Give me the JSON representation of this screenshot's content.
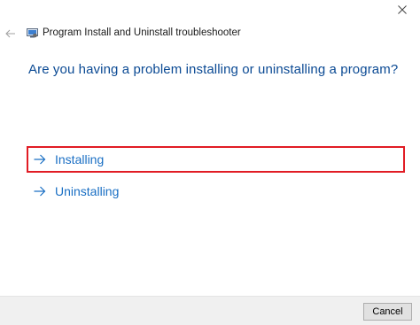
{
  "window": {
    "title": "Program Install and Uninstall troubleshooter",
    "close_icon": "close-icon",
    "back_icon": "back-arrow-icon",
    "app_icon": "troubleshooter-app-icon"
  },
  "main": {
    "question": "Are you having a problem installing or uninstalling a program?",
    "options": [
      {
        "label": "Installing",
        "icon": "arrow-right-icon",
        "highlighted": true
      },
      {
        "label": "Uninstalling",
        "icon": "arrow-right-icon",
        "highlighted": false
      }
    ]
  },
  "footer": {
    "cancel_label": "Cancel"
  },
  "colors": {
    "question_text": "#0b4a94",
    "option_text": "#1a6fc4",
    "highlight_border": "#e11c24",
    "footer_bg": "#f0f0f0"
  }
}
